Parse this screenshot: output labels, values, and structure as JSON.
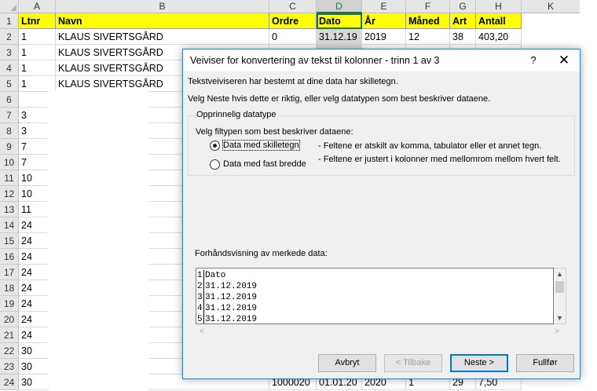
{
  "sheet": {
    "columns": [
      "A",
      "B",
      "C",
      "D",
      "E",
      "F",
      "G",
      "H",
      "K"
    ],
    "selected_column": "D",
    "header_row": [
      "Ltnr",
      "Navn",
      "Ordre",
      "Dato",
      "År",
      "Måned",
      "Art",
      "Antall"
    ],
    "row_numbers": [
      "1",
      "2",
      "3",
      "4",
      "5",
      "6",
      "7",
      "8",
      "9",
      "10",
      "11",
      "12",
      "13",
      "14",
      "15",
      "16",
      "17",
      "18",
      "19",
      "20",
      "21",
      "22",
      "23",
      "24"
    ],
    "rows": [
      [
        "1",
        "KLAUS SIVERTSGÅRD",
        "0",
        "31.12.19",
        "2019",
        "12",
        "38",
        "403,20"
      ],
      [
        "1",
        "KLAUS SIVERTSGÅRD"
      ],
      [
        "1",
        "KLAUS SIVERTSGÅRD"
      ],
      [
        "1",
        "KLAUS SIVERTSGÅRD"
      ],
      [
        ""
      ],
      [
        "3"
      ],
      [
        "3"
      ],
      [
        "7"
      ],
      [
        "7"
      ],
      [
        "10"
      ],
      [
        "10"
      ],
      [
        "11"
      ],
      [
        "24"
      ],
      [
        "24"
      ],
      [
        "24"
      ],
      [
        "24"
      ],
      [
        "24"
      ],
      [
        "24"
      ],
      [
        "24"
      ],
      [
        "24"
      ],
      [
        "30"
      ],
      [
        "30"
      ],
      [
        "30",
        "",
        "1000020",
        "01.01.20",
        "2020",
        "1",
        "29",
        "7,50"
      ]
    ]
  },
  "dialog": {
    "title": "Veiviser for konvertering av tekst til kolonner - trinn 1 av 3",
    "help_label": "?",
    "close_label": "✕",
    "intro_line1": "Tekstveiviseren har bestemt at dine data har skilletegn.",
    "intro_line2": "Velg Neste hvis dette er riktig, eller velg datatypen som best beskriver dataene.",
    "group_legend": "Opprinnelig datatype",
    "group_prompt": "Velg filtypen som best beskriver dataene:",
    "option_delimited_label": "Data med skilletegn",
    "option_delimited_desc": "- Feltene er atskilt av komma, tabulator eller et annet tegn.",
    "option_fixed_label": "Data med fast bredde",
    "option_fixed_desc": "- Feltene er justert i kolonner med mellomrom mellom hvert felt.",
    "preview_label": "Forhåndsvisning av merkede data:",
    "preview_lines": [
      {
        "n": "1",
        "text": "Dato"
      },
      {
        "n": "2",
        "text": "31.12.2019"
      },
      {
        "n": "3",
        "text": "31.12.2019"
      },
      {
        "n": "4",
        "text": "31.12.2019"
      },
      {
        "n": "5",
        "text": "31.12.2019"
      }
    ],
    "buttons": {
      "cancel": "Avbryt",
      "back": "< Tilbake",
      "next": "Neste >",
      "finish": "Fullfør"
    }
  },
  "colors": {
    "header_fill": "#ffff00",
    "selection_green": "#217346",
    "dialog_border": "#3c7fb1",
    "default_button_border": "#0078d7"
  }
}
